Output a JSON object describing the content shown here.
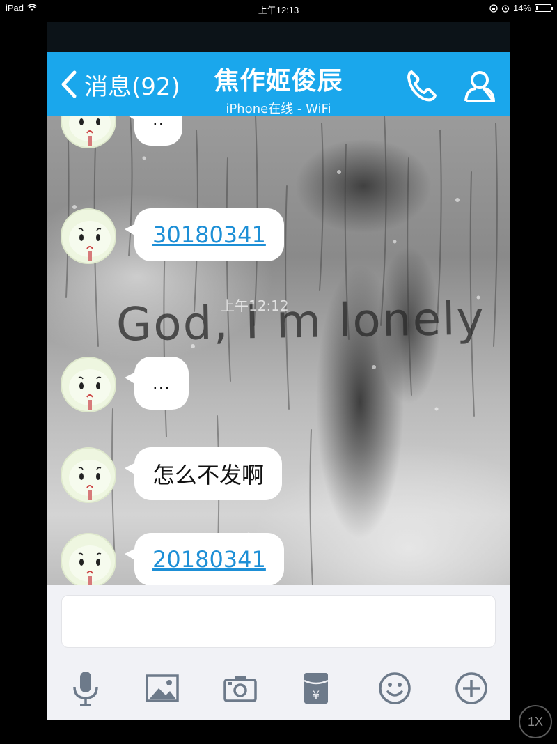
{
  "status_bar": {
    "device": "iPad",
    "time": "上午12:13",
    "battery": "14%",
    "battery_fraction": 0.14,
    "icons": [
      "wifi-icon",
      "rotation-lock-icon",
      "alarm-icon",
      "battery-icon"
    ]
  },
  "nav": {
    "back_label": "消息(92)",
    "title": "焦作姬俊辰",
    "subtitle": "iPhone在线 - WiFi",
    "phone_icon": "phone-icon",
    "profile_icon": "profile-icon",
    "background_color": "#1aa7ec"
  },
  "background": {
    "overlay_text": "God, I m lonely",
    "time_text": "上午12:12"
  },
  "messages": [
    {
      "text": "..",
      "type": "text"
    },
    {
      "text": "30180341",
      "type": "link"
    },
    {
      "text": "...",
      "type": "text"
    },
    {
      "text": "怎么不发啊",
      "type": "text"
    },
    {
      "text": "20180341",
      "type": "link"
    }
  ],
  "input": {
    "value": "",
    "placeholder": ""
  },
  "toolbar": [
    "microphone-icon",
    "image-icon",
    "camera-icon",
    "red-packet-icon",
    "emoji-icon",
    "add-icon"
  ],
  "zoom_badge": "1X",
  "colors": {
    "link": "#1d8fd6",
    "toolbar_icon": "#6d7a8a"
  }
}
